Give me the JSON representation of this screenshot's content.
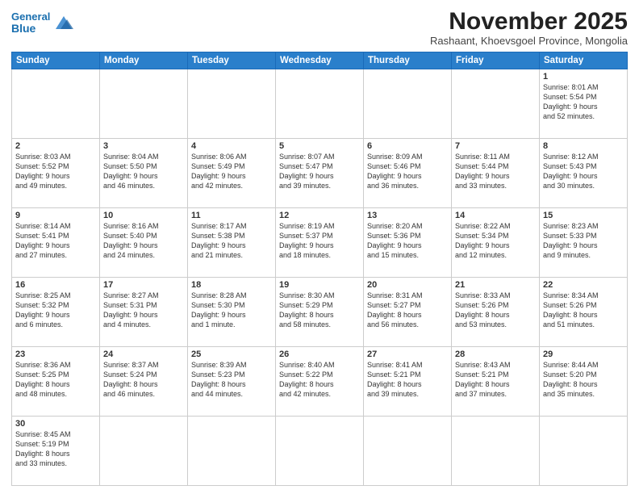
{
  "header": {
    "logo_line1": "General",
    "logo_line2": "Blue",
    "month": "November 2025",
    "location": "Rashaant, Khoevsgoel Province, Mongolia"
  },
  "days_of_week": [
    "Sunday",
    "Monday",
    "Tuesday",
    "Wednesday",
    "Thursday",
    "Friday",
    "Saturday"
  ],
  "weeks": [
    [
      {
        "day": "",
        "info": ""
      },
      {
        "day": "",
        "info": ""
      },
      {
        "day": "",
        "info": ""
      },
      {
        "day": "",
        "info": ""
      },
      {
        "day": "",
        "info": ""
      },
      {
        "day": "",
        "info": ""
      },
      {
        "day": "1",
        "info": "Sunrise: 8:01 AM\nSunset: 5:54 PM\nDaylight: 9 hours\nand 52 minutes."
      }
    ],
    [
      {
        "day": "2",
        "info": "Sunrise: 8:03 AM\nSunset: 5:52 PM\nDaylight: 9 hours\nand 49 minutes."
      },
      {
        "day": "3",
        "info": "Sunrise: 8:04 AM\nSunset: 5:50 PM\nDaylight: 9 hours\nand 46 minutes."
      },
      {
        "day": "4",
        "info": "Sunrise: 8:06 AM\nSunset: 5:49 PM\nDaylight: 9 hours\nand 42 minutes."
      },
      {
        "day": "5",
        "info": "Sunrise: 8:07 AM\nSunset: 5:47 PM\nDaylight: 9 hours\nand 39 minutes."
      },
      {
        "day": "6",
        "info": "Sunrise: 8:09 AM\nSunset: 5:46 PM\nDaylight: 9 hours\nand 36 minutes."
      },
      {
        "day": "7",
        "info": "Sunrise: 8:11 AM\nSunset: 5:44 PM\nDaylight: 9 hours\nand 33 minutes."
      },
      {
        "day": "8",
        "info": "Sunrise: 8:12 AM\nSunset: 5:43 PM\nDaylight: 9 hours\nand 30 minutes."
      }
    ],
    [
      {
        "day": "9",
        "info": "Sunrise: 8:14 AM\nSunset: 5:41 PM\nDaylight: 9 hours\nand 27 minutes."
      },
      {
        "day": "10",
        "info": "Sunrise: 8:16 AM\nSunset: 5:40 PM\nDaylight: 9 hours\nand 24 minutes."
      },
      {
        "day": "11",
        "info": "Sunrise: 8:17 AM\nSunset: 5:38 PM\nDaylight: 9 hours\nand 21 minutes."
      },
      {
        "day": "12",
        "info": "Sunrise: 8:19 AM\nSunset: 5:37 PM\nDaylight: 9 hours\nand 18 minutes."
      },
      {
        "day": "13",
        "info": "Sunrise: 8:20 AM\nSunset: 5:36 PM\nDaylight: 9 hours\nand 15 minutes."
      },
      {
        "day": "14",
        "info": "Sunrise: 8:22 AM\nSunset: 5:34 PM\nDaylight: 9 hours\nand 12 minutes."
      },
      {
        "day": "15",
        "info": "Sunrise: 8:23 AM\nSunset: 5:33 PM\nDaylight: 9 hours\nand 9 minutes."
      }
    ],
    [
      {
        "day": "16",
        "info": "Sunrise: 8:25 AM\nSunset: 5:32 PM\nDaylight: 9 hours\nand 6 minutes."
      },
      {
        "day": "17",
        "info": "Sunrise: 8:27 AM\nSunset: 5:31 PM\nDaylight: 9 hours\nand 4 minutes."
      },
      {
        "day": "18",
        "info": "Sunrise: 8:28 AM\nSunset: 5:30 PM\nDaylight: 9 hours\nand 1 minute."
      },
      {
        "day": "19",
        "info": "Sunrise: 8:30 AM\nSunset: 5:29 PM\nDaylight: 8 hours\nand 58 minutes."
      },
      {
        "day": "20",
        "info": "Sunrise: 8:31 AM\nSunset: 5:27 PM\nDaylight: 8 hours\nand 56 minutes."
      },
      {
        "day": "21",
        "info": "Sunrise: 8:33 AM\nSunset: 5:26 PM\nDaylight: 8 hours\nand 53 minutes."
      },
      {
        "day": "22",
        "info": "Sunrise: 8:34 AM\nSunset: 5:26 PM\nDaylight: 8 hours\nand 51 minutes."
      }
    ],
    [
      {
        "day": "23",
        "info": "Sunrise: 8:36 AM\nSunset: 5:25 PM\nDaylight: 8 hours\nand 48 minutes."
      },
      {
        "day": "24",
        "info": "Sunrise: 8:37 AM\nSunset: 5:24 PM\nDaylight: 8 hours\nand 46 minutes."
      },
      {
        "day": "25",
        "info": "Sunrise: 8:39 AM\nSunset: 5:23 PM\nDaylight: 8 hours\nand 44 minutes."
      },
      {
        "day": "26",
        "info": "Sunrise: 8:40 AM\nSunset: 5:22 PM\nDaylight: 8 hours\nand 42 minutes."
      },
      {
        "day": "27",
        "info": "Sunrise: 8:41 AM\nSunset: 5:21 PM\nDaylight: 8 hours\nand 39 minutes."
      },
      {
        "day": "28",
        "info": "Sunrise: 8:43 AM\nSunset: 5:21 PM\nDaylight: 8 hours\nand 37 minutes."
      },
      {
        "day": "29",
        "info": "Sunrise: 8:44 AM\nSunset: 5:20 PM\nDaylight: 8 hours\nand 35 minutes."
      }
    ],
    [
      {
        "day": "30",
        "info": "Sunrise: 8:45 AM\nSunset: 5:19 PM\nDaylight: 8 hours\nand 33 minutes."
      },
      {
        "day": "",
        "info": ""
      },
      {
        "day": "",
        "info": ""
      },
      {
        "day": "",
        "info": ""
      },
      {
        "day": "",
        "info": ""
      },
      {
        "day": "",
        "info": ""
      },
      {
        "day": "",
        "info": ""
      }
    ]
  ]
}
